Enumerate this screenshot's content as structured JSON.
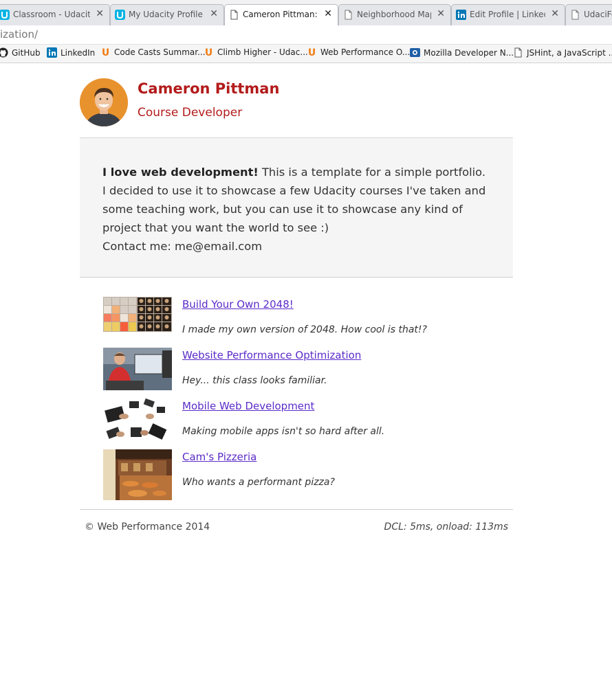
{
  "browser": {
    "tabs": [
      {
        "label": "Classroom - Udacity",
        "icon": "udacity-icon"
      },
      {
        "label": "My Udacity Profile",
        "icon": "udacity-icon"
      },
      {
        "label": "Cameron Pittman: Po",
        "icon": "page-icon",
        "active": true
      },
      {
        "label": "Neighborhood Map",
        "icon": "page-icon"
      },
      {
        "label": "Edit Profile | LinkedIn",
        "icon": "linkedin-icon"
      },
      {
        "label": "UdaciFe",
        "icon": "page-icon"
      }
    ],
    "url": "ization/",
    "bookmarks": [
      {
        "label": "GitHub",
        "icon": "github-icon"
      },
      {
        "label": "LinkedIn",
        "icon": "linkedin-icon"
      },
      {
        "label": "Code Casts Summar...",
        "icon": "udacity-u-icon"
      },
      {
        "label": "Climb Higher - Udac...",
        "icon": "udacity-u-icon"
      },
      {
        "label": "Web Performance O...",
        "icon": "udacity-u-icon"
      },
      {
        "label": "Mozilla Developer N...",
        "icon": "mdn-icon"
      },
      {
        "label": "JSHint, a JavaScript ...",
        "icon": "page-icon"
      }
    ],
    "colors": {
      "udacity": "#02b3e4",
      "linkedin": "#0077b5",
      "udacity_u": "#f27d15"
    }
  },
  "header": {
    "name": "Cameron Pittman",
    "role": "Course Developer",
    "color": "#b31b1b"
  },
  "intro": {
    "bold": "I love web development!",
    "text": " This is a template for a simple portfolio. I decided to use it to showcase a few Udacity courses I've taken and some teaching work, but you can use it to showcase any kind of project that you want the world to see :)",
    "contact": "Contact me: me@email.com"
  },
  "projects": [
    {
      "title": "Build Your Own 2048!",
      "desc": "I made my own version of 2048. How cool is that!?",
      "thumb": "2048-grid"
    },
    {
      "title": "Website Performance Optimization",
      "desc": "Hey... this class looks familiar.",
      "thumb": "presenter-photo"
    },
    {
      "title": "Mobile Web Development",
      "desc": "Making mobile apps isn't so hard after all.",
      "thumb": "devices-photo"
    },
    {
      "title": "Cam's Pizzeria",
      "desc": "Who wants a performant pizza?",
      "thumb": "pizzeria-photo"
    }
  ],
  "footer": {
    "copyright": "© Web Performance 2014",
    "perf": "DCL: 5ms, onload: 113ms"
  }
}
